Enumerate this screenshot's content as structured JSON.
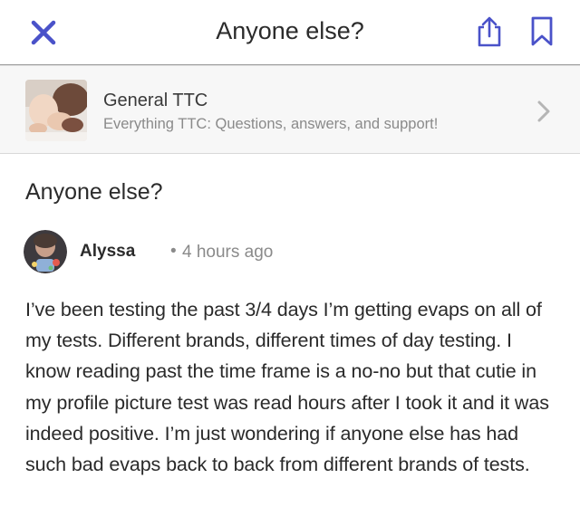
{
  "header": {
    "title": "Anyone else?",
    "close_icon": "close-icon",
    "share_icon": "share-icon",
    "bookmark_icon": "bookmark-icon",
    "accent_color": "#4a52c9"
  },
  "group": {
    "name": "General TTC",
    "description": "Everything TTC: Questions, answers, and support!",
    "chevron_icon": "chevron-right-icon"
  },
  "post": {
    "title": "Anyone else?",
    "author": "Alyssa",
    "separator": "•",
    "time": "4 hours ago",
    "body": "I’ve been testing the past 3/4 days I’m getting evaps on all of my tests. Different brands, different times of day testing. I know reading past the time frame is a no-no but that cutie in my profile picture test was read hours after I took it and it was indeed positive. I’m just wondering if anyone else has had such bad evaps back to back from different brands of tests."
  }
}
